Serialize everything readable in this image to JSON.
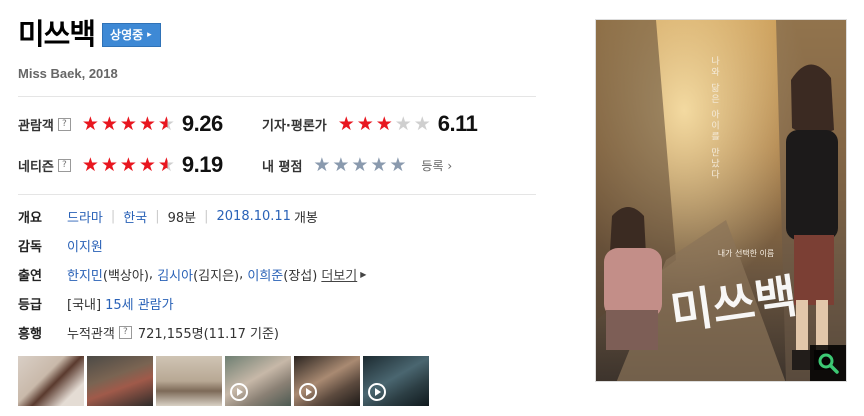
{
  "movie": {
    "title": "미쓰백",
    "status": "상영중",
    "subtitle": "Miss Baek, 2018"
  },
  "scores": {
    "audience": {
      "label": "관람객",
      "help": "?",
      "rating": 9.26,
      "value": "9.26"
    },
    "critics": {
      "label": "기자·평론가",
      "rating": 6.11,
      "value": "6.11"
    },
    "netizen": {
      "label": "네티즌",
      "help": "?",
      "rating": 9.19,
      "value": "9.19"
    },
    "my_rating": {
      "label": "내 평점",
      "register": "등록"
    }
  },
  "info": {
    "overview": {
      "key": "개요",
      "genre": "드라마",
      "country": "한국",
      "runtime": "98분",
      "release_date": "2018.10.11",
      "release_suffix": "개봉"
    },
    "director": {
      "key": "감독",
      "name": "이지원"
    },
    "cast": {
      "key": "출연",
      "actors": [
        {
          "name": "한지민",
          "role": "(백상아)"
        },
        {
          "name": "김시아",
          "role": "(김지은)"
        },
        {
          "name": "이희준",
          "role": "(장섭)"
        }
      ],
      "more": "더보기"
    },
    "rating": {
      "key": "등급",
      "prefix": "[국내]",
      "grade": "15세 관람가"
    },
    "box_office": {
      "key": "흥행",
      "label": "누적관객",
      "help": "?",
      "value": "721,155명",
      "basis": "(11.17 기준)"
    }
  },
  "thumbnails": [
    {
      "kind": "photo"
    },
    {
      "kind": "photo"
    },
    {
      "kind": "photo"
    },
    {
      "kind": "video"
    },
    {
      "kind": "video"
    },
    {
      "kind": "video"
    }
  ],
  "poster": {
    "title_art": "미쓰백",
    "vertical_text": "나와 닮은 아이를 만났다",
    "tagline": "내가 선택한 이름",
    "zoom_icon": "magnifier-icon"
  },
  "colors": {
    "star_on": "#e8161f",
    "star_off": "#cfcfcf",
    "star_gray": "#8a9aae",
    "link": "#2a62b7",
    "badge": "#3e89d5"
  }
}
